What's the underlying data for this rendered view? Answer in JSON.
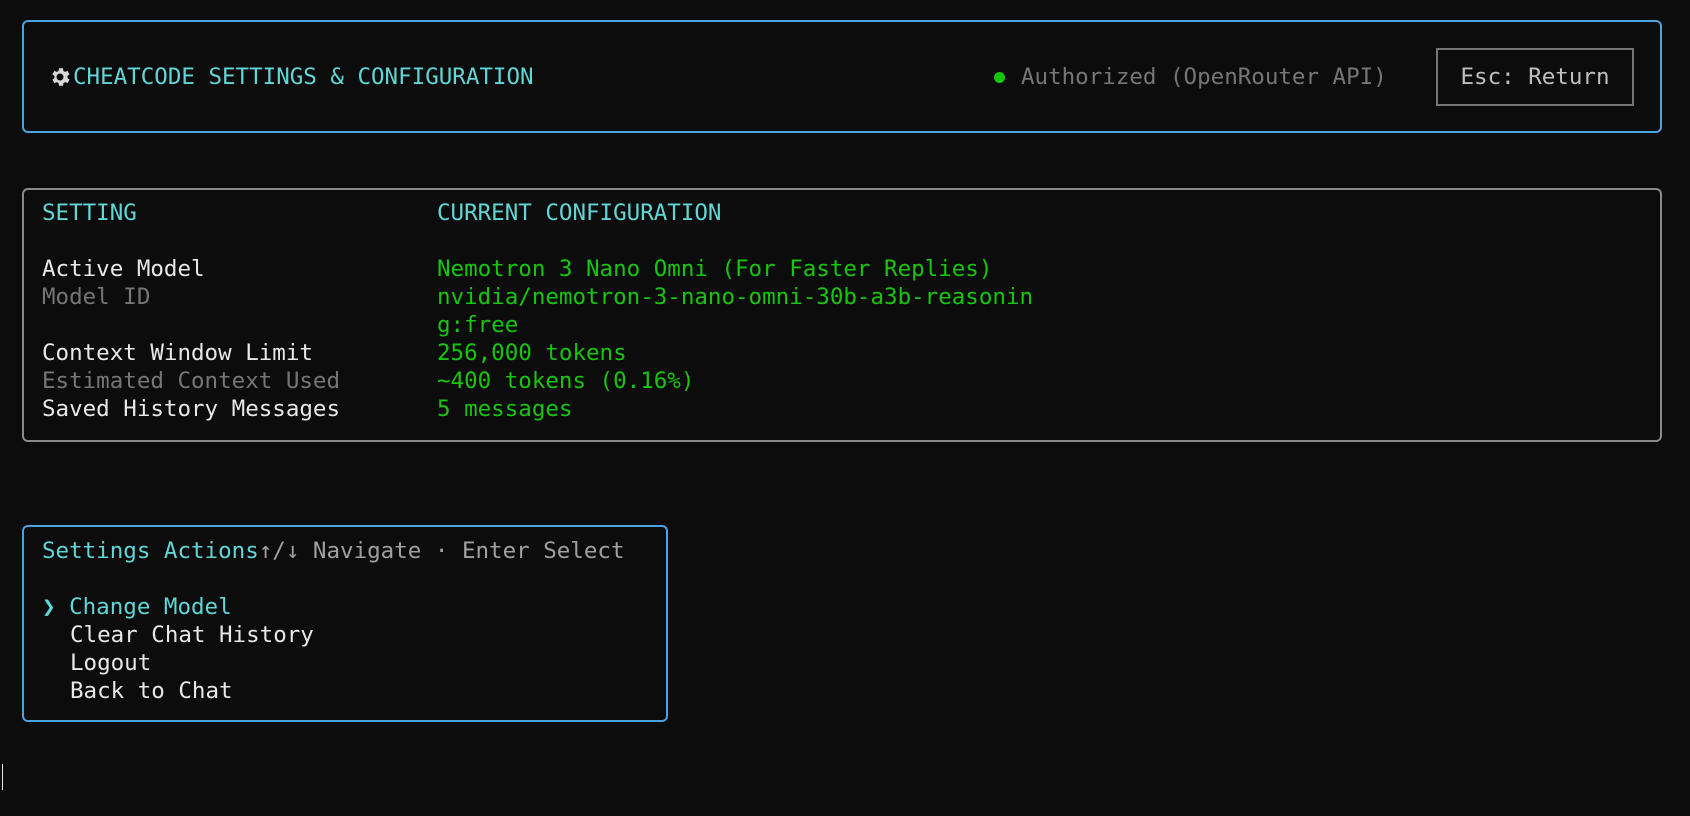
{
  "header": {
    "title": "CHEATCODE SETTINGS & CONFIGURATION",
    "icon": "gear-icon",
    "auth_status": "Authorized (OpenRouter API)",
    "auth_color": "#16c60c",
    "esc_label": "Esc: Return"
  },
  "config": {
    "col_setting": "SETTING",
    "col_current": "CURRENT CONFIGURATION",
    "rows": [
      {
        "label": "Active Model",
        "value": "Nemotron 3 Nano Omni (For Faster Replies)"
      },
      {
        "label": "Model ID",
        "value": "nvidia/nemotron-3-nano-omni-30b-a3b-reasonin",
        "value_cont": "g:free"
      },
      {
        "label": "Context Window Limit",
        "value": "256,000 tokens"
      },
      {
        "label": "Estimated Context Used",
        "value": "~400 tokens (0.16%)"
      },
      {
        "label": "Saved History Messages",
        "value": "5 messages"
      }
    ]
  },
  "actions": {
    "title": "Settings Actions",
    "hint": "↑/↓ Navigate · Enter Select",
    "selector": "❯",
    "items": [
      {
        "label": "Change Model",
        "selected": true
      },
      {
        "label": "Clear Chat History",
        "selected": false
      },
      {
        "label": "Logout",
        "selected": false
      },
      {
        "label": "Back to Chat",
        "selected": false
      }
    ]
  },
  "colors": {
    "accent_cyan": "#61d6d6",
    "value_green": "#16c60c",
    "border_blue": "#4aa3e0",
    "background": "#0c0c0c"
  }
}
